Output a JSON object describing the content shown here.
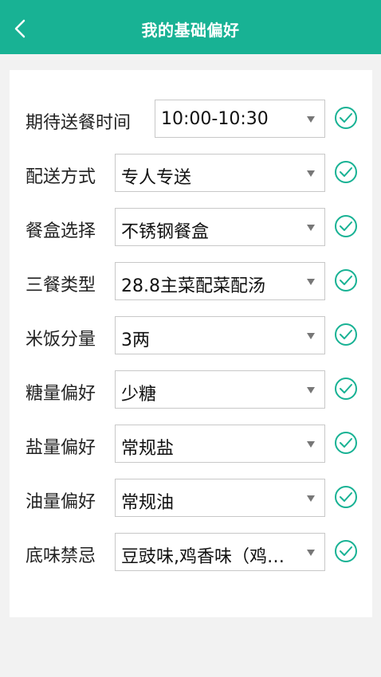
{
  "header": {
    "title": "我的基础偏好"
  },
  "accent_color": "#18b294",
  "preferences": [
    {
      "label": "期待送餐时间",
      "value": "10:00-10:30"
    },
    {
      "label": "配送方式",
      "value": "专人专送"
    },
    {
      "label": "餐盒选择",
      "value": "不锈钢餐盒"
    },
    {
      "label": "三餐类型",
      "value": "28.8主菜配菜配汤"
    },
    {
      "label": "米饭分量",
      "value": "3两"
    },
    {
      "label": "糖量偏好",
      "value": "少糖"
    },
    {
      "label": "盐量偏好",
      "value": "常规盐"
    },
    {
      "label": "油量偏好",
      "value": "常规油"
    },
    {
      "label": "底味禁忌",
      "value": "豆豉味,鸡香味（鸡…"
    }
  ],
  "icons": {
    "back": "chevron-left-icon",
    "dropdown": "triangle-down-icon",
    "confirm": "check-circle-icon"
  }
}
